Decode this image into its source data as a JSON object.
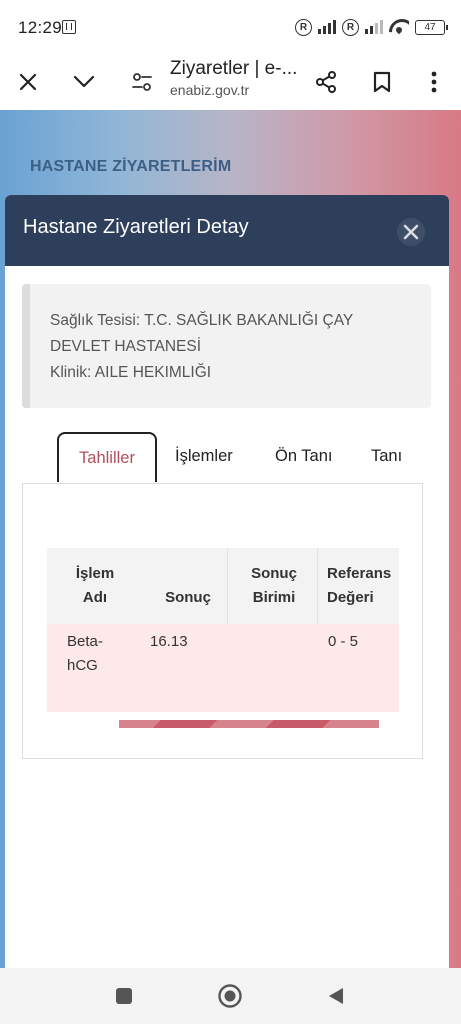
{
  "status_bar": {
    "time": "12:29",
    "r_badge": "R",
    "battery": "47"
  },
  "browser": {
    "title": "Ziyaretler | e-...",
    "url": "enabiz.gov.tr"
  },
  "page": {
    "heading": "HASTANE ZİYARETLERİM"
  },
  "modal": {
    "title": "Hastane Ziyaretleri Detay",
    "info": {
      "facility_line1": "Sağlık Tesisi: T.C. SAĞLIK BAKANLIĞI ÇAY",
      "facility_line2": "DEVLET HASTANESİ",
      "clinic": "Klinik: AILE HEKIMLIĞI"
    },
    "tabs": [
      {
        "label": "Tahliller",
        "active": true
      },
      {
        "label": "İşlemler",
        "active": false
      },
      {
        "label": "Ön Tanı",
        "active": false
      },
      {
        "label": "Tanı",
        "active": false
      }
    ],
    "table": {
      "headers": [
        {
          "line1": "İşlem",
          "line2": "Adı"
        },
        {
          "line1": "Sonuç",
          "line2": ""
        },
        {
          "line1": "Sonuç",
          "line2": "Birimi"
        },
        {
          "line1": "Referans",
          "line2": "Değeri"
        }
      ],
      "rows": [
        {
          "name_line1": "Beta-",
          "name_line2": "hCG",
          "result": "16.13",
          "unit": "",
          "reference": "0 - 5"
        }
      ]
    }
  },
  "colors": {
    "header_bg": "#2d3f5a",
    "active_tab_text": "#b0505c",
    "row_highlight": "#fde9ea",
    "heading_text": "#3e5f85"
  }
}
